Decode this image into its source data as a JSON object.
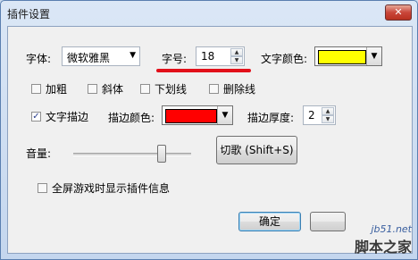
{
  "window": {
    "title": "插件设置",
    "close_symbol": "✕"
  },
  "font": {
    "label": "字体:",
    "value": "微软雅黑",
    "arrow": "▼"
  },
  "size": {
    "label": "字号:",
    "value": "18",
    "up": "▲",
    "down": "▼"
  },
  "text_color": {
    "label": "文字颜色:",
    "color": "#ffff00",
    "arrow": "▼"
  },
  "style_checks": [
    {
      "label": "加粗",
      "checked": false
    },
    {
      "label": "斜体",
      "checked": false
    },
    {
      "label": "下划线",
      "checked": false
    },
    {
      "label": "删除线",
      "checked": false
    }
  ],
  "outline": {
    "checkbox_label": "文字描边",
    "checked": true,
    "check_mark": "✓",
    "color_label": "描边颜色:",
    "color": "#ff0000",
    "thickness_label": "描边厚度:",
    "thickness_value": "2"
  },
  "volume": {
    "label": "音量:",
    "level_percent": 77
  },
  "switch_song_button": "切歌 (Shift+S)",
  "fullscreen_info": {
    "label": "全屏游戏时显示插件信息",
    "checked": false
  },
  "ok_button": "确定",
  "watermark": {
    "url": "jb51.net",
    "name": "脚本之家"
  },
  "colors": {
    "annotation_underline": "#e2101a"
  }
}
